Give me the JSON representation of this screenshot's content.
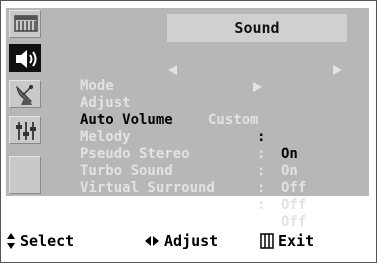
{
  "title": "Sound",
  "menu": {
    "mode": {
      "label": "Mode",
      "value": "Custom"
    },
    "adjust": {
      "label": "Adjust"
    },
    "items": [
      {
        "label": "Auto Volume",
        "colon": ":",
        "value": "On",
        "highlighted": true
      },
      {
        "label": "Melody",
        "colon": ":",
        "value": "On",
        "highlighted": false
      },
      {
        "label": "Pseudo Stereo",
        "colon": ":",
        "value": "Off",
        "highlighted": false
      },
      {
        "label": "Turbo Sound",
        "colon": ":",
        "value": "Off",
        "highlighted": false
      },
      {
        "label": "Virtual Surround",
        "colon": ":",
        "value": "Off",
        "highlighted": false
      }
    ]
  },
  "sidebar": {
    "items": [
      {
        "icon": "picture-icon",
        "active": false
      },
      {
        "icon": "speaker-icon",
        "active": true
      },
      {
        "icon": "satellite-dish-icon",
        "active": false
      },
      {
        "icon": "equalizer-sliders-icon",
        "active": false
      }
    ]
  },
  "footer": {
    "select": "Select",
    "adjust": "Adjust",
    "exit": "Exit"
  },
  "colors": {
    "panel": "#b7b7b7",
    "highlight_text": "#000000",
    "dim_text": "#e2e2e2",
    "active_tab": "#101010"
  }
}
